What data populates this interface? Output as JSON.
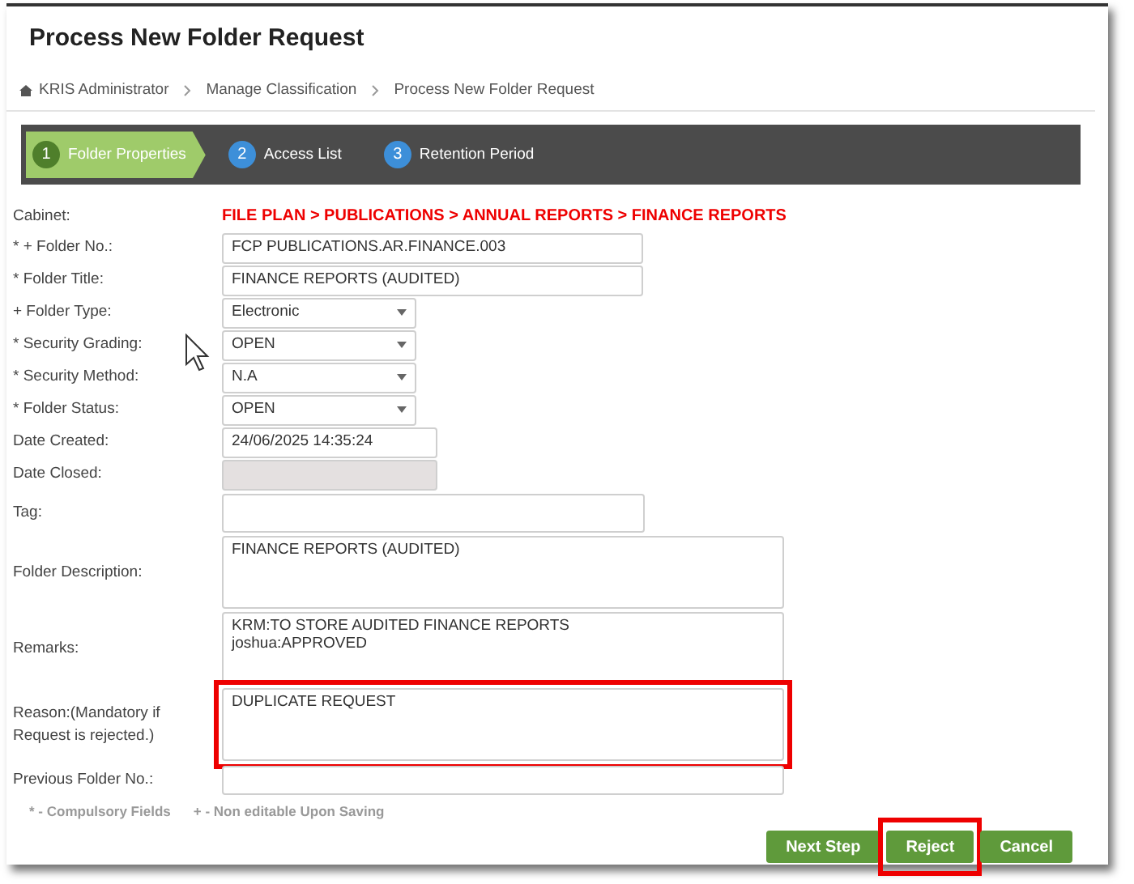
{
  "title": "Process New Folder Request",
  "breadcrumb": [
    {
      "label": "KRIS Administrator"
    },
    {
      "label": "Manage Classification"
    },
    {
      "label": "Process New Folder Request"
    }
  ],
  "steps": [
    {
      "number": "1",
      "label": "Folder Properties",
      "selected": true
    },
    {
      "number": "2",
      "label": "Access List",
      "selected": false
    },
    {
      "number": "3",
      "label": "Retention Period",
      "selected": false
    }
  ],
  "cabinet": {
    "label": "Cabinet:",
    "path": "FILE PLAN > PUBLICATIONS > ANNUAL REPORTS > FINANCE REPORTS"
  },
  "fields": [
    {
      "kind": "text",
      "label": "* + Folder No.:",
      "value": "FCP PUBLICATIONS.AR.FINANCE.003",
      "disabled": false,
      "highlighted": false
    },
    {
      "kind": "text",
      "label": "* Folder Title:",
      "value": "FINANCE REPORTS (AUDITED)",
      "disabled": false,
      "highlighted": false
    },
    {
      "kind": "select",
      "label": "+ Folder Type:",
      "value": "Electronic",
      "disabled": false,
      "highlighted": false
    },
    {
      "kind": "select",
      "label": "* Security Grading:",
      "value": "OPEN",
      "disabled": false,
      "highlighted": false
    },
    {
      "kind": "select",
      "label": "* Security Method:",
      "value": "N.A",
      "disabled": false,
      "highlighted": false
    },
    {
      "kind": "select",
      "label": "* Folder Status:",
      "value": "OPEN",
      "disabled": false,
      "highlighted": false
    },
    {
      "kind": "date",
      "label": "Date Created:",
      "value": "24/06/2025 14:35:24",
      "disabled": false,
      "highlighted": false
    },
    {
      "kind": "date",
      "label": "Date Closed:",
      "disabled": true,
      "highlighted": false
    },
    {
      "kind": "tall",
      "label": "Tag:",
      "disabled": false,
      "highlighted": false
    },
    {
      "kind": "textarea",
      "label": "Folder Description:",
      "value": "FINANCE REPORTS (AUDITED)",
      "disabled": false,
      "highlighted": false
    },
    {
      "kind": "textarea",
      "label": "Remarks:",
      "value": "KRM:TO STORE AUDITED FINANCE REPORTS\njoshua:APPROVED",
      "disabled": false,
      "highlighted": false
    },
    {
      "kind": "textarea",
      "label": "Reason:(Mandatory if Request is rejected.)",
      "value": "DUPLICATE REQUEST",
      "disabled": false,
      "highlighted": true
    },
    {
      "kind": "long",
      "label": "Previous Folder No.:",
      "disabled": false,
      "highlighted": false
    }
  ],
  "footnotes": [
    "* - Compulsory Fields",
    "+ - Non editable Upon Saving"
  ],
  "buttons": [
    {
      "label": "Next Step",
      "highlighted": false
    },
    {
      "label": "Reject",
      "highlighted": true
    },
    {
      "label": "Cancel",
      "highlighted": false
    }
  ]
}
